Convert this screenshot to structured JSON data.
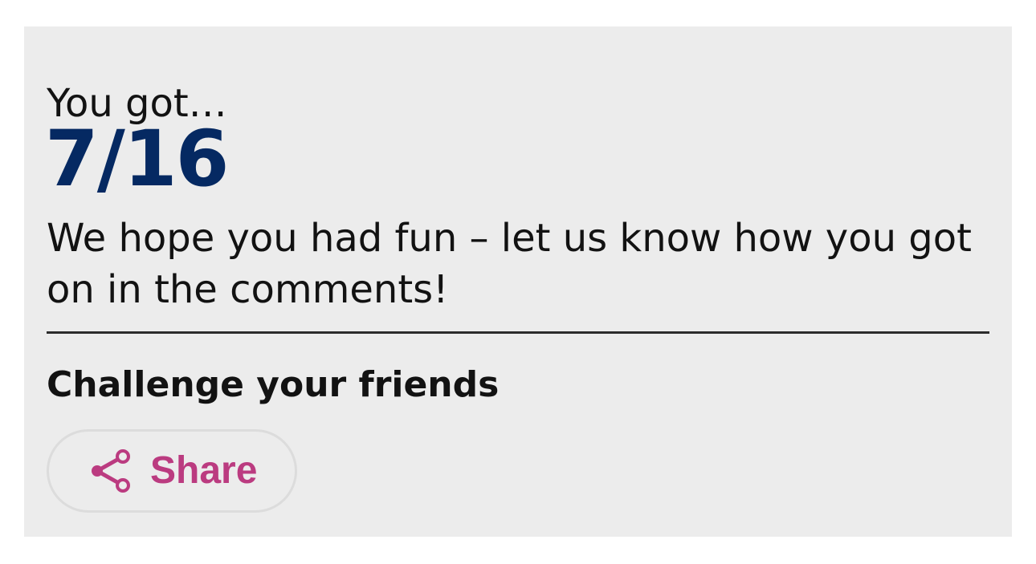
{
  "result": {
    "lead": "You got…",
    "score": "7/16",
    "message": "We hope you had fun – let us know how you got on in the comments!"
  },
  "share": {
    "heading": "Challenge your friends",
    "button_label": "Share",
    "icon": "share-icon"
  },
  "colors": {
    "background": "#ececec",
    "score": "#052962",
    "accent": "#bb3b80"
  }
}
